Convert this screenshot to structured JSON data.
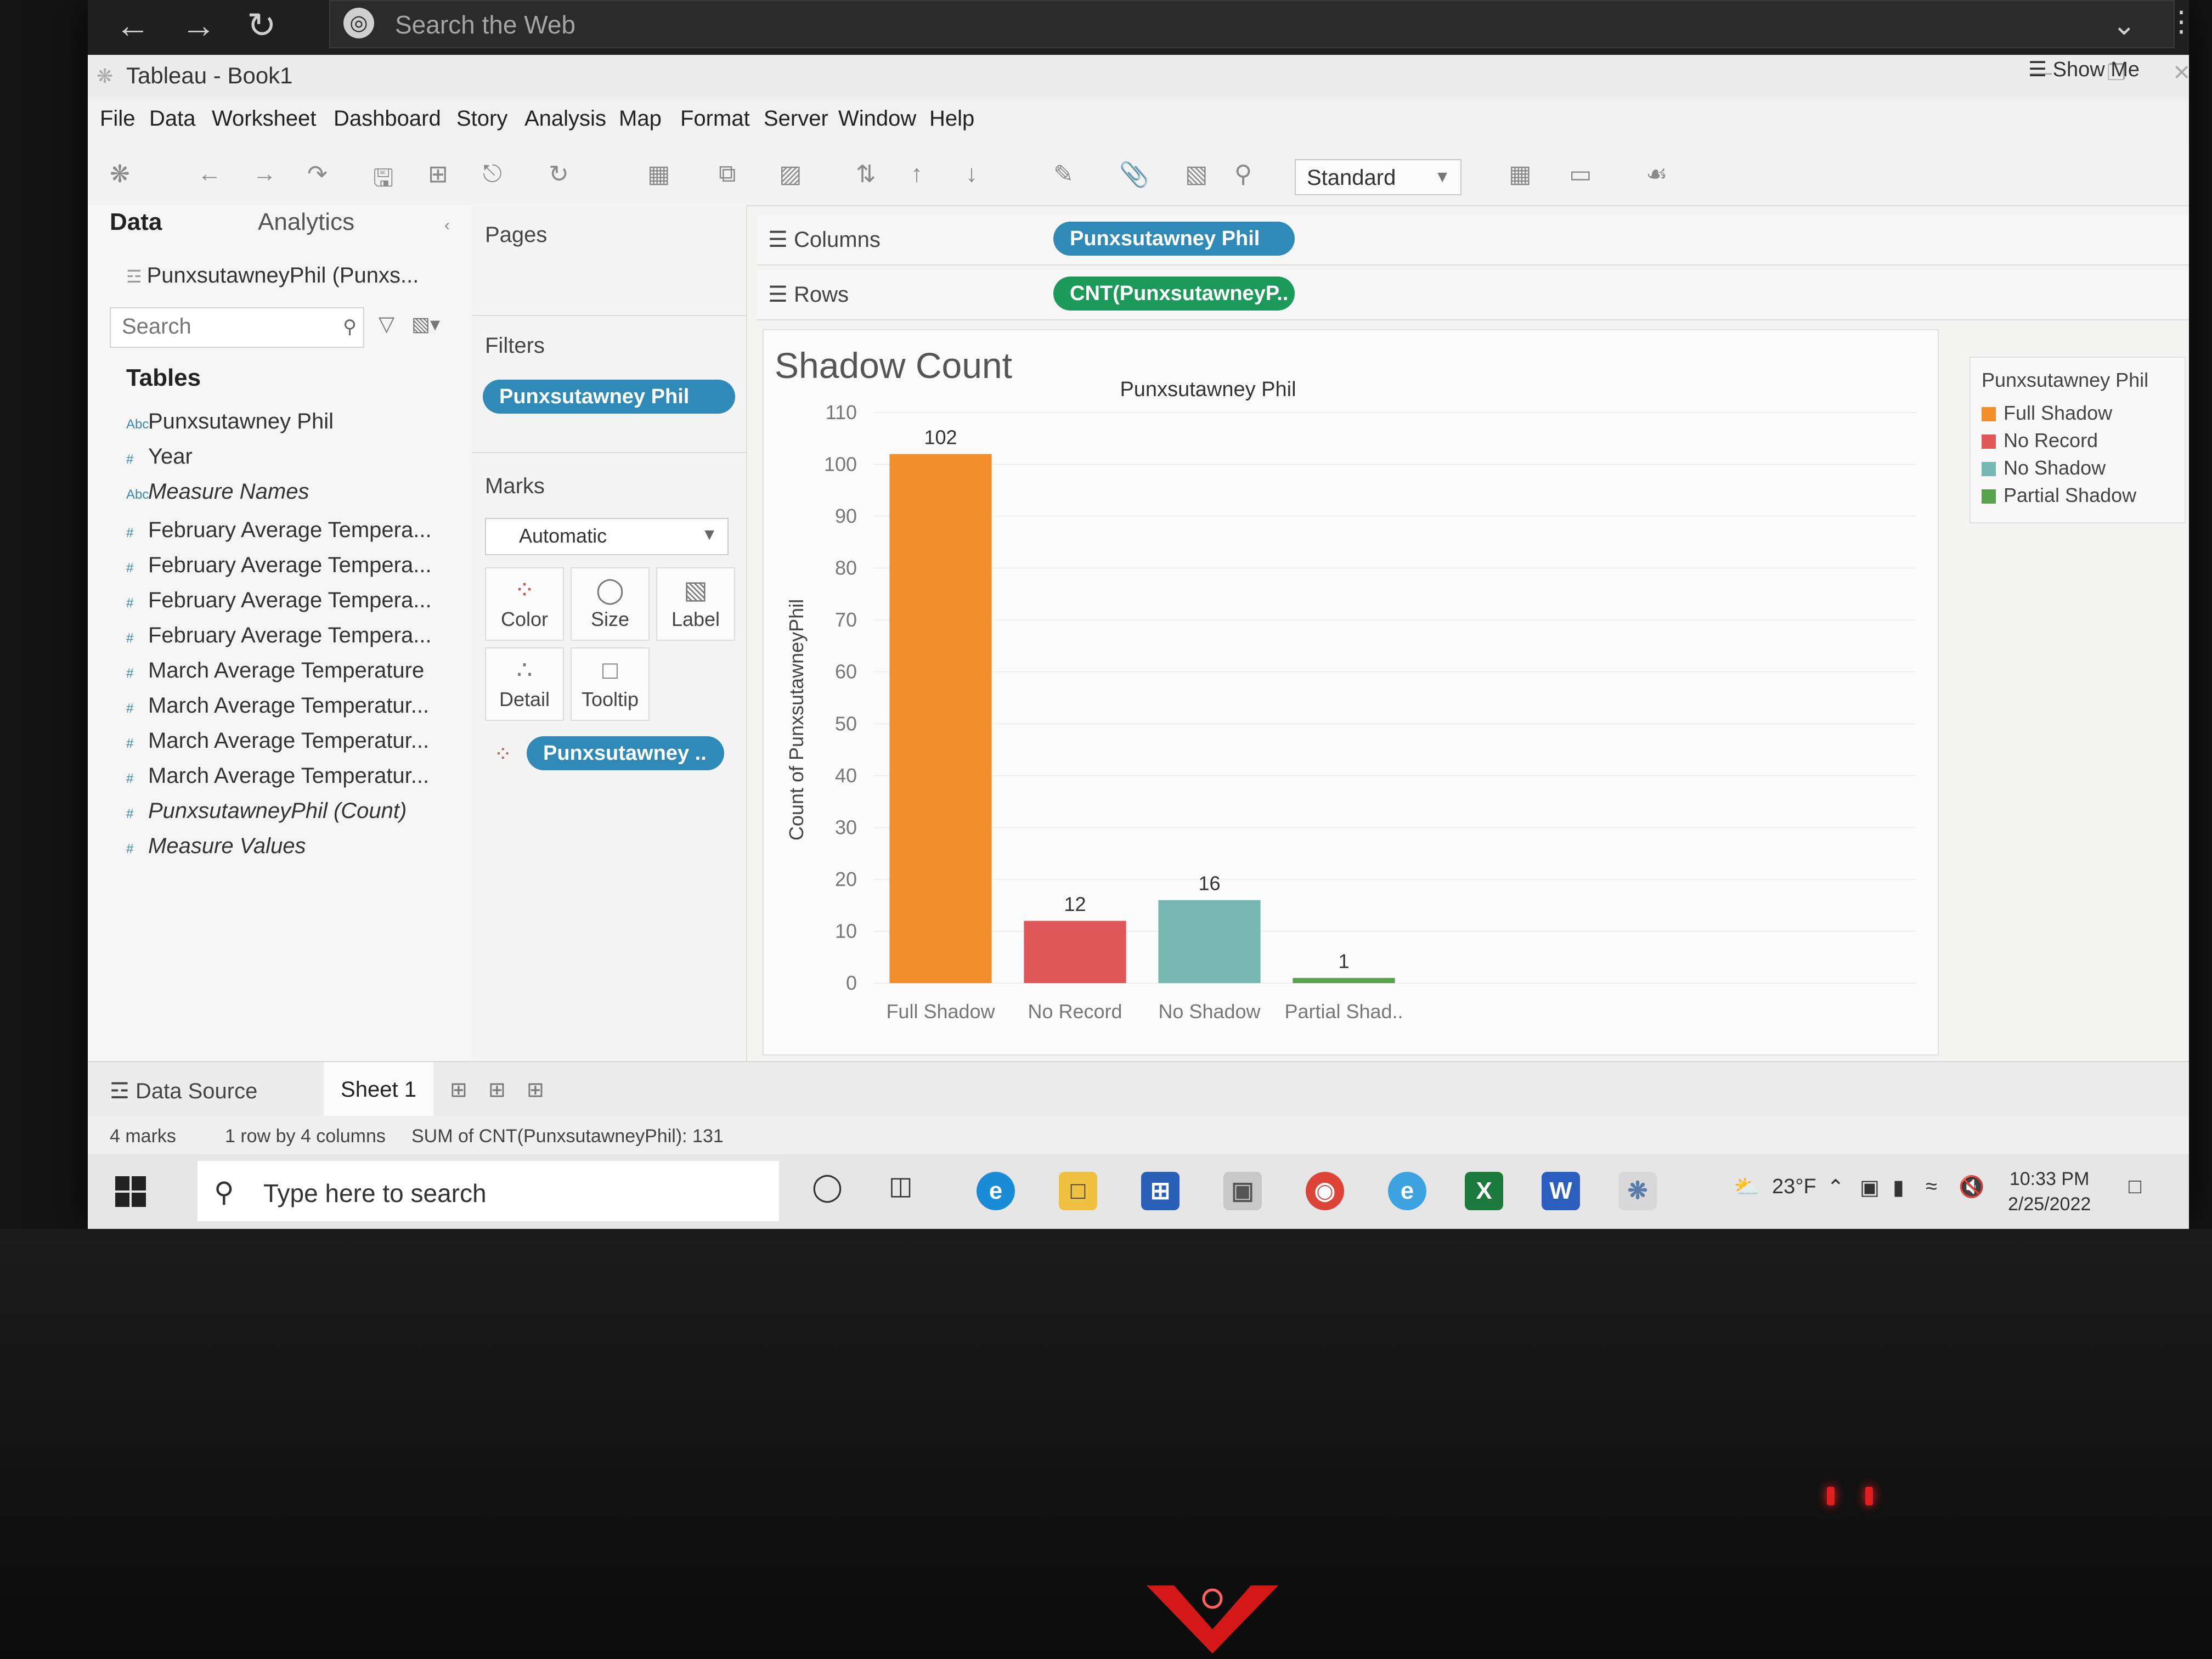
{
  "browser": {
    "search_placeholder": "Search the Web"
  },
  "window": {
    "title": "Tableau - Book1"
  },
  "menu": [
    "File",
    "Data",
    "Worksheet",
    "Dashboard",
    "Story",
    "Analysis",
    "Map",
    "Format",
    "Server",
    "Window",
    "Help"
  ],
  "toolbar": {
    "fit_select": "Standard",
    "show_me": "Show Me"
  },
  "data_pane": {
    "tab_data": "Data",
    "tab_analytics": "Analytics",
    "datasource": "PunxsutawneyPhil (Punxs...",
    "search_placeholder": "Search",
    "tables_heading": "Tables",
    "fields": [
      {
        "icon": "Abc",
        "name": "Punxsutawney Phil"
      },
      {
        "icon": "#",
        "name": "Year"
      },
      {
        "icon": "Abc",
        "name": "Measure Names"
      },
      {
        "icon": "#",
        "name": "February Average Tempera..."
      },
      {
        "icon": "#",
        "name": "February Average Tempera..."
      },
      {
        "icon": "#",
        "name": "February Average Tempera..."
      },
      {
        "icon": "#",
        "name": "February Average Tempera..."
      },
      {
        "icon": "#",
        "name": "March Average Temperature"
      },
      {
        "icon": "#",
        "name": "March Average Temperatur..."
      },
      {
        "icon": "#",
        "name": "March Average Temperatur..."
      },
      {
        "icon": "#",
        "name": "March Average Temperatur..."
      },
      {
        "icon": "#",
        "name": "PunxsutawneyPhil (Count)"
      },
      {
        "icon": "#",
        "name": "Measure Values"
      }
    ]
  },
  "cards": {
    "pages": "Pages",
    "filters": "Filters",
    "filter_pill": "Punxsutawney Phil",
    "marks": "Marks",
    "mark_type": "Automatic",
    "mark_buttons": [
      "Color",
      "Size",
      "Label",
      "Detail",
      "Tooltip"
    ],
    "color_pill": "Punxsutawney .."
  },
  "shelves": {
    "columns_label": "Columns",
    "columns_pill": "Punxsutawney Phil",
    "rows_label": "Rows",
    "rows_pill": "CNT(PunxsutawneyP.."
  },
  "viz": {
    "sheet_title": "Shadow Count",
    "header": "Punxsutawney Phil"
  },
  "legend": {
    "title": "Punxsutawney Phil",
    "items": [
      {
        "label": "Full Shadow",
        "color": "#f28e2b"
      },
      {
        "label": "No Record",
        "color": "#e15759"
      },
      {
        "label": "No Shadow",
        "color": "#76b7b2"
      },
      {
        "label": "Partial Shadow",
        "color": "#59a14f"
      }
    ]
  },
  "chart_data": {
    "type": "bar",
    "title": "Punxsutawney Phil",
    "ylabel": "Count of PunxsutawneyPhil",
    "xlabel": "",
    "categories": [
      "Full Shadow",
      "No Record",
      "No Shadow",
      "Partial Shad.."
    ],
    "values": [
      102,
      12,
      16,
      1
    ],
    "data_labels": [
      "102",
      "12",
      "16",
      "1"
    ],
    "colors": [
      "#f28e2b",
      "#e15759",
      "#76b7b2",
      "#59a14f"
    ],
    "ylim": [
      0,
      110
    ],
    "yticks": [
      0,
      10,
      20,
      30,
      40,
      50,
      60,
      70,
      80,
      90,
      100,
      110
    ]
  },
  "sheets": {
    "data_source": "Data Source",
    "sheet1": "Sheet 1"
  },
  "status": {
    "marks": "4 marks",
    "dims": "1 row by 4 columns",
    "sum": "SUM of CNT(PunxsutawneyPhil): 131"
  },
  "taskbar": {
    "search_placeholder": "Type here to search",
    "weather": "23°F",
    "time": "10:33 PM",
    "date": "2/25/2022"
  }
}
